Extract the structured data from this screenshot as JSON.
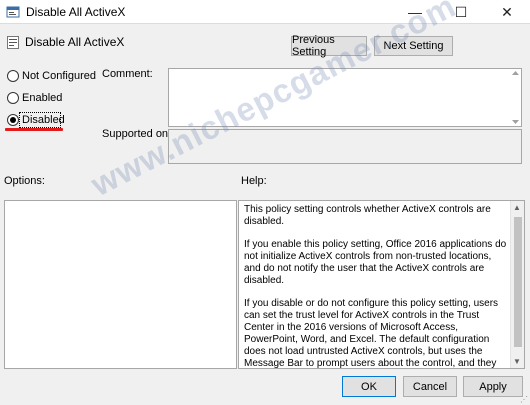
{
  "window": {
    "title": "Disable All ActiveX",
    "controls": {
      "minimize": "—",
      "maximize": "☐",
      "close": "✕"
    }
  },
  "header": {
    "policy_name": "Disable All ActiveX",
    "previous_setting": "Previous Setting",
    "next_setting": "Next Setting"
  },
  "state": {
    "options": [
      {
        "label": "Not Configured",
        "selected": false
      },
      {
        "label": "Enabled",
        "selected": false
      },
      {
        "label": "Disabled",
        "selected": true
      }
    ],
    "highlight_color": "#e21a1a"
  },
  "comment": {
    "label": "Comment:",
    "value": ""
  },
  "supported": {
    "label": "Supported on:",
    "value": ""
  },
  "options_panel": {
    "label": "Options:"
  },
  "help": {
    "label": "Help:",
    "paragraphs": [
      "This policy setting controls whether ActiveX controls are disabled.",
      "If you enable this policy setting, Office 2016 applications do not initialize ActiveX controls from non-trusted locations, and do not notify the user that the ActiveX controls are disabled.",
      "If you disable or do not configure this policy setting, users can set the trust level for ActiveX controls in the Trust Center in the 2016 versions of Microsoft Access, PowerPoint, Word, and Excel. The default configuration does not load untrusted ActiveX controls, but uses the Message Bar to prompt users about the control, and they can then choose whether to run the control."
    ]
  },
  "footer": {
    "ok": "OK",
    "cancel": "Cancel",
    "apply": "Apply"
  },
  "watermark": "www.nichepcgamer.com",
  "colors": {
    "accent": "#0078d7",
    "window_bg": "#f0f0f0"
  }
}
